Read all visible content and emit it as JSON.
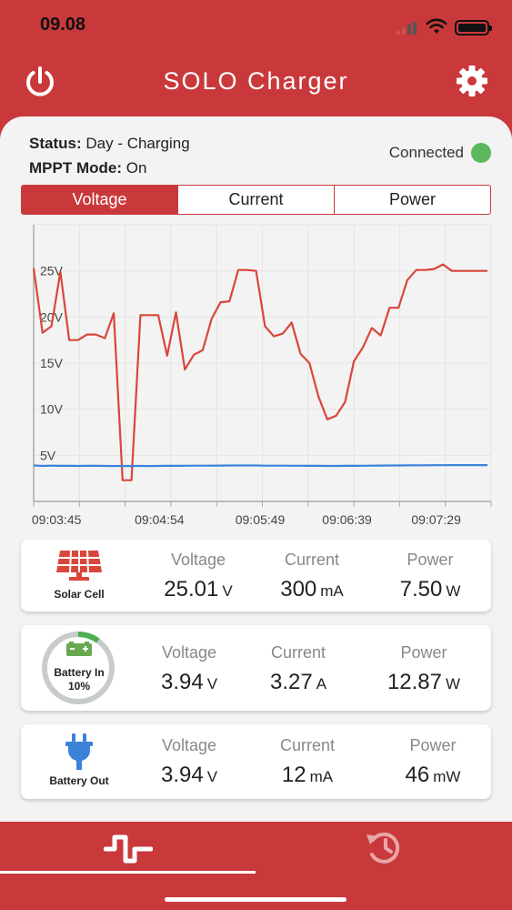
{
  "status_bar": {
    "time": "09.08"
  },
  "header": {
    "title": "SOLO Charger",
    "power_icon": "power-icon",
    "settings_icon": "gear-icon"
  },
  "status": {
    "status_label": "Status:",
    "status_value": "Day - Charging",
    "mppt_label": "MPPT Mode:",
    "mppt_value": "On",
    "connection": "Connected",
    "connection_color": "#5cb85c"
  },
  "tabs": [
    {
      "label": "Voltage",
      "active": true
    },
    {
      "label": "Current",
      "active": false
    },
    {
      "label": "Power",
      "active": false
    }
  ],
  "chart_data": {
    "type": "line",
    "y_ticks": [
      "5V",
      "10V",
      "15V",
      "20V",
      "25V"
    ],
    "ylim": [
      0,
      30
    ],
    "x_ticks": [
      "09:03:45",
      "09:04:54",
      "09:05:49",
      "09:06:39",
      "09:07:29"
    ],
    "series": [
      {
        "color": "#d9463b",
        "values": [
          25.3,
          18.3,
          19.0,
          24.9,
          17.5,
          17.5,
          18.1,
          18.1,
          17.7,
          20.4,
          2.3,
          2.3,
          20.2,
          20.2,
          20.2,
          15.8,
          20.5,
          14.3,
          15.9,
          16.4,
          19.8,
          21.6,
          21.7,
          25.1,
          25.1,
          25.0,
          19.0,
          17.9,
          18.2,
          19.4,
          16.0,
          15.0,
          11.4,
          8.9,
          9.3,
          10.8,
          15.2,
          16.7,
          18.8,
          18.0,
          21.0,
          21.0,
          24.0,
          25.1,
          25.1,
          25.2,
          25.7,
          25.0,
          25.0,
          25.0,
          25.0,
          25.0
        ]
      },
      {
        "color": "#3b82d9",
        "values": [
          3.9,
          3.85,
          3.88,
          3.86,
          3.87,
          3.85,
          3.86,
          3.87,
          3.85,
          3.84,
          3.85,
          3.84,
          3.85,
          3.84,
          3.85,
          3.86,
          3.86,
          3.87,
          3.88,
          3.88,
          3.88,
          3.89,
          3.9,
          3.9,
          3.9,
          3.9,
          3.88,
          3.88,
          3.88,
          3.87,
          3.87,
          3.86,
          3.86,
          3.85,
          3.85,
          3.86,
          3.86,
          3.87,
          3.88,
          3.89,
          3.9,
          3.9,
          3.91,
          3.92,
          3.92,
          3.93,
          3.93,
          3.94,
          3.94,
          3.94,
          3.94,
          3.94
        ]
      }
    ]
  },
  "cards": {
    "solar": {
      "label": "Solar Cell",
      "icon": "solar-panel-icon",
      "voltage_label": "Voltage",
      "voltage": "25.01",
      "voltage_unit": "V",
      "current_label": "Current",
      "current": "300",
      "current_unit": "mA",
      "power_label": "Power",
      "power": "7.50",
      "power_unit": "W"
    },
    "battery_in": {
      "label_line1": "Battery In",
      "label_line2": "10%",
      "level": 0.1,
      "icon": "battery-icon",
      "voltage_label": "Voltage",
      "voltage": "3.94",
      "voltage_unit": "V",
      "current_label": "Current",
      "current": "3.27",
      "current_unit": "A",
      "power_label": "Power",
      "power": "12.87",
      "power_unit": "W"
    },
    "battery_out": {
      "label": "Battery Out",
      "icon": "plug-icon",
      "voltage_label": "Voltage",
      "voltage": "3.94",
      "voltage_unit": "V",
      "current_label": "Current",
      "current": "12",
      "current_unit": "mA",
      "power_label": "Power",
      "power": "46",
      "power_unit": "mW"
    }
  },
  "tabbar": {
    "live_icon": "pulse-wave-icon",
    "history_icon": "history-icon",
    "active": "live"
  }
}
